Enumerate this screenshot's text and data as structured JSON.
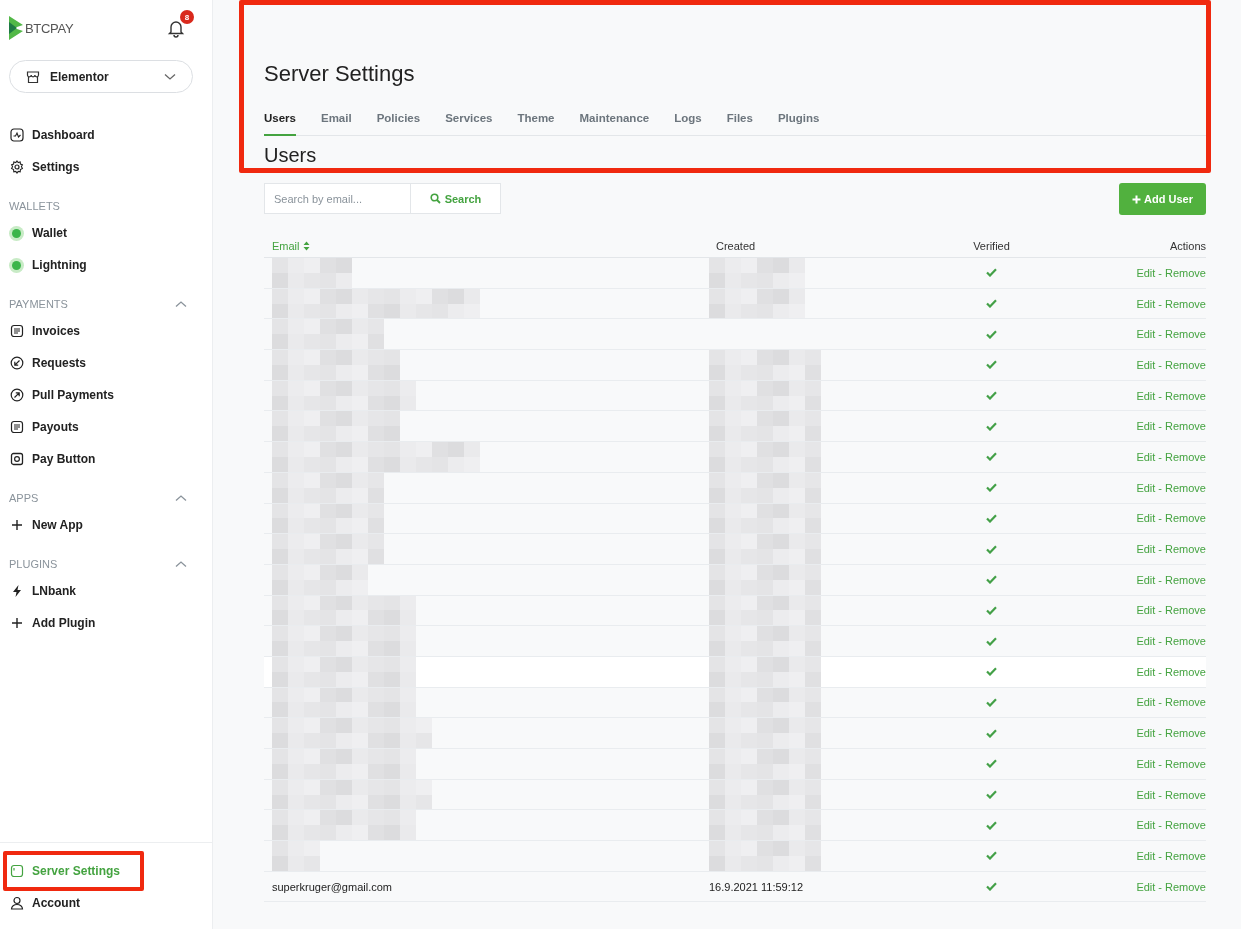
{
  "sidebar": {
    "logo": "BTCPAY",
    "notifications": {
      "count": "8"
    },
    "store": {
      "name": "Elementor"
    },
    "top_items": [
      {
        "kind": "dashboard",
        "label": "Dashboard",
        "selected": false
      },
      {
        "kind": "settings",
        "label": "Settings",
        "selected": false
      }
    ],
    "sections": [
      {
        "title": "WALLETS",
        "kind": "static",
        "items": [
          {
            "kind": "wallet",
            "label": "Wallet",
            "color": "#3bb54a"
          },
          {
            "kind": "wallet",
            "label": "Lightning",
            "color": "#3bb54a"
          }
        ]
      },
      {
        "title": "PAYMENTS",
        "kind": "collapsible",
        "expanded": true,
        "items": [
          {
            "kind": "invoices",
            "label": "Invoices"
          },
          {
            "kind": "requests",
            "label": "Requests"
          },
          {
            "kind": "pull",
            "label": "Pull Payments"
          },
          {
            "kind": "invoices",
            "label": "Payouts"
          },
          {
            "kind": "paybutton",
            "label": "Pay Button"
          }
        ]
      },
      {
        "title": "APPS",
        "kind": "collapsible",
        "expanded": true,
        "items": [
          {
            "kind": "add",
            "label": "New App"
          }
        ]
      },
      {
        "title": "PLUGINS",
        "kind": "collapsible",
        "expanded": true,
        "items": [
          {
            "kind": "lightning",
            "label": "LNbank"
          },
          {
            "kind": "add",
            "label": "Add Plugin"
          }
        ]
      }
    ],
    "bottom_items": [
      {
        "kind": "server",
        "label": "Server Settings",
        "selected": true,
        "highlighted": true
      },
      {
        "kind": "account",
        "label": "Account",
        "selected": false,
        "highlighted": false
      }
    ]
  },
  "page": {
    "title": "Server Settings",
    "highlighted": true,
    "tabs": [
      {
        "label": "Users",
        "selected": true
      },
      {
        "label": "Email",
        "selected": false
      },
      {
        "label": "Policies",
        "selected": false
      },
      {
        "label": "Services",
        "selected": false
      },
      {
        "label": "Theme",
        "selected": false
      },
      {
        "label": "Maintenance",
        "selected": false
      },
      {
        "label": "Logs",
        "selected": false
      },
      {
        "label": "Files",
        "selected": false
      },
      {
        "label": "Plugins",
        "selected": false
      }
    ],
    "section_title": "Users",
    "search": {
      "placeholder": "Search by email...",
      "button": "Search"
    },
    "add_button": "Add User",
    "table": {
      "columns": [
        "Email",
        "Created",
        "Verified",
        "Actions"
      ],
      "rows": [
        {
          "redacted": true,
          "hovered": false,
          "verified": true,
          "edit": "Edit",
          "separator": "-",
          "remove": "Remove"
        },
        {
          "redacted": true,
          "hovered": false,
          "verified": true,
          "edit": "Edit",
          "separator": "-",
          "remove": "Remove"
        },
        {
          "redacted": true,
          "hovered": false,
          "verified": true,
          "edit": "Edit",
          "separator": "-",
          "remove": "Remove"
        },
        {
          "redacted": true,
          "hovered": false,
          "verified": true,
          "edit": "Edit",
          "separator": "-",
          "remove": "Remove"
        },
        {
          "redacted": true,
          "hovered": false,
          "verified": true,
          "edit": "Edit",
          "separator": "-",
          "remove": "Remove"
        },
        {
          "redacted": true,
          "hovered": false,
          "verified": true,
          "edit": "Edit",
          "separator": "-",
          "remove": "Remove"
        },
        {
          "redacted": true,
          "hovered": false,
          "verified": true,
          "edit": "Edit",
          "separator": "-",
          "remove": "Remove"
        },
        {
          "redacted": true,
          "hovered": false,
          "verified": true,
          "edit": "Edit",
          "separator": "-",
          "remove": "Remove"
        },
        {
          "redacted": true,
          "hovered": false,
          "verified": true,
          "edit": "Edit",
          "separator": "-",
          "remove": "Remove"
        },
        {
          "redacted": true,
          "hovered": false,
          "verified": true,
          "edit": "Edit",
          "separator": "-",
          "remove": "Remove"
        },
        {
          "redacted": true,
          "hovered": false,
          "verified": true,
          "edit": "Edit",
          "separator": "-",
          "remove": "Remove"
        },
        {
          "redacted": true,
          "hovered": false,
          "verified": true,
          "edit": "Edit",
          "separator": "-",
          "remove": "Remove"
        },
        {
          "redacted": true,
          "hovered": false,
          "verified": true,
          "edit": "Edit",
          "separator": "-",
          "remove": "Remove"
        },
        {
          "redacted": true,
          "hovered": true,
          "verified": true,
          "edit": "Edit",
          "separator": "-",
          "remove": "Remove"
        },
        {
          "redacted": true,
          "hovered": false,
          "verified": true,
          "edit": "Edit",
          "separator": "-",
          "remove": "Remove"
        },
        {
          "redacted": true,
          "hovered": false,
          "verified": true,
          "edit": "Edit",
          "separator": "-",
          "remove": "Remove"
        },
        {
          "redacted": true,
          "hovered": false,
          "verified": true,
          "edit": "Edit",
          "separator": "-",
          "remove": "Remove"
        },
        {
          "redacted": true,
          "hovered": false,
          "verified": true,
          "edit": "Edit",
          "separator": "-",
          "remove": "Remove"
        },
        {
          "redacted": true,
          "hovered": false,
          "verified": true,
          "edit": "Edit",
          "separator": "-",
          "remove": "Remove"
        },
        {
          "redacted": true,
          "hovered": false,
          "verified": true,
          "edit": "Edit",
          "separator": "-",
          "remove": "Remove"
        },
        {
          "redacted": false,
          "hovered": false,
          "email": "superkruger@gmail.com",
          "created": "16.9.2021 11:59:12",
          "verified": true,
          "edit": "Edit",
          "separator": "-",
          "remove": "Remove"
        }
      ]
    }
  }
}
